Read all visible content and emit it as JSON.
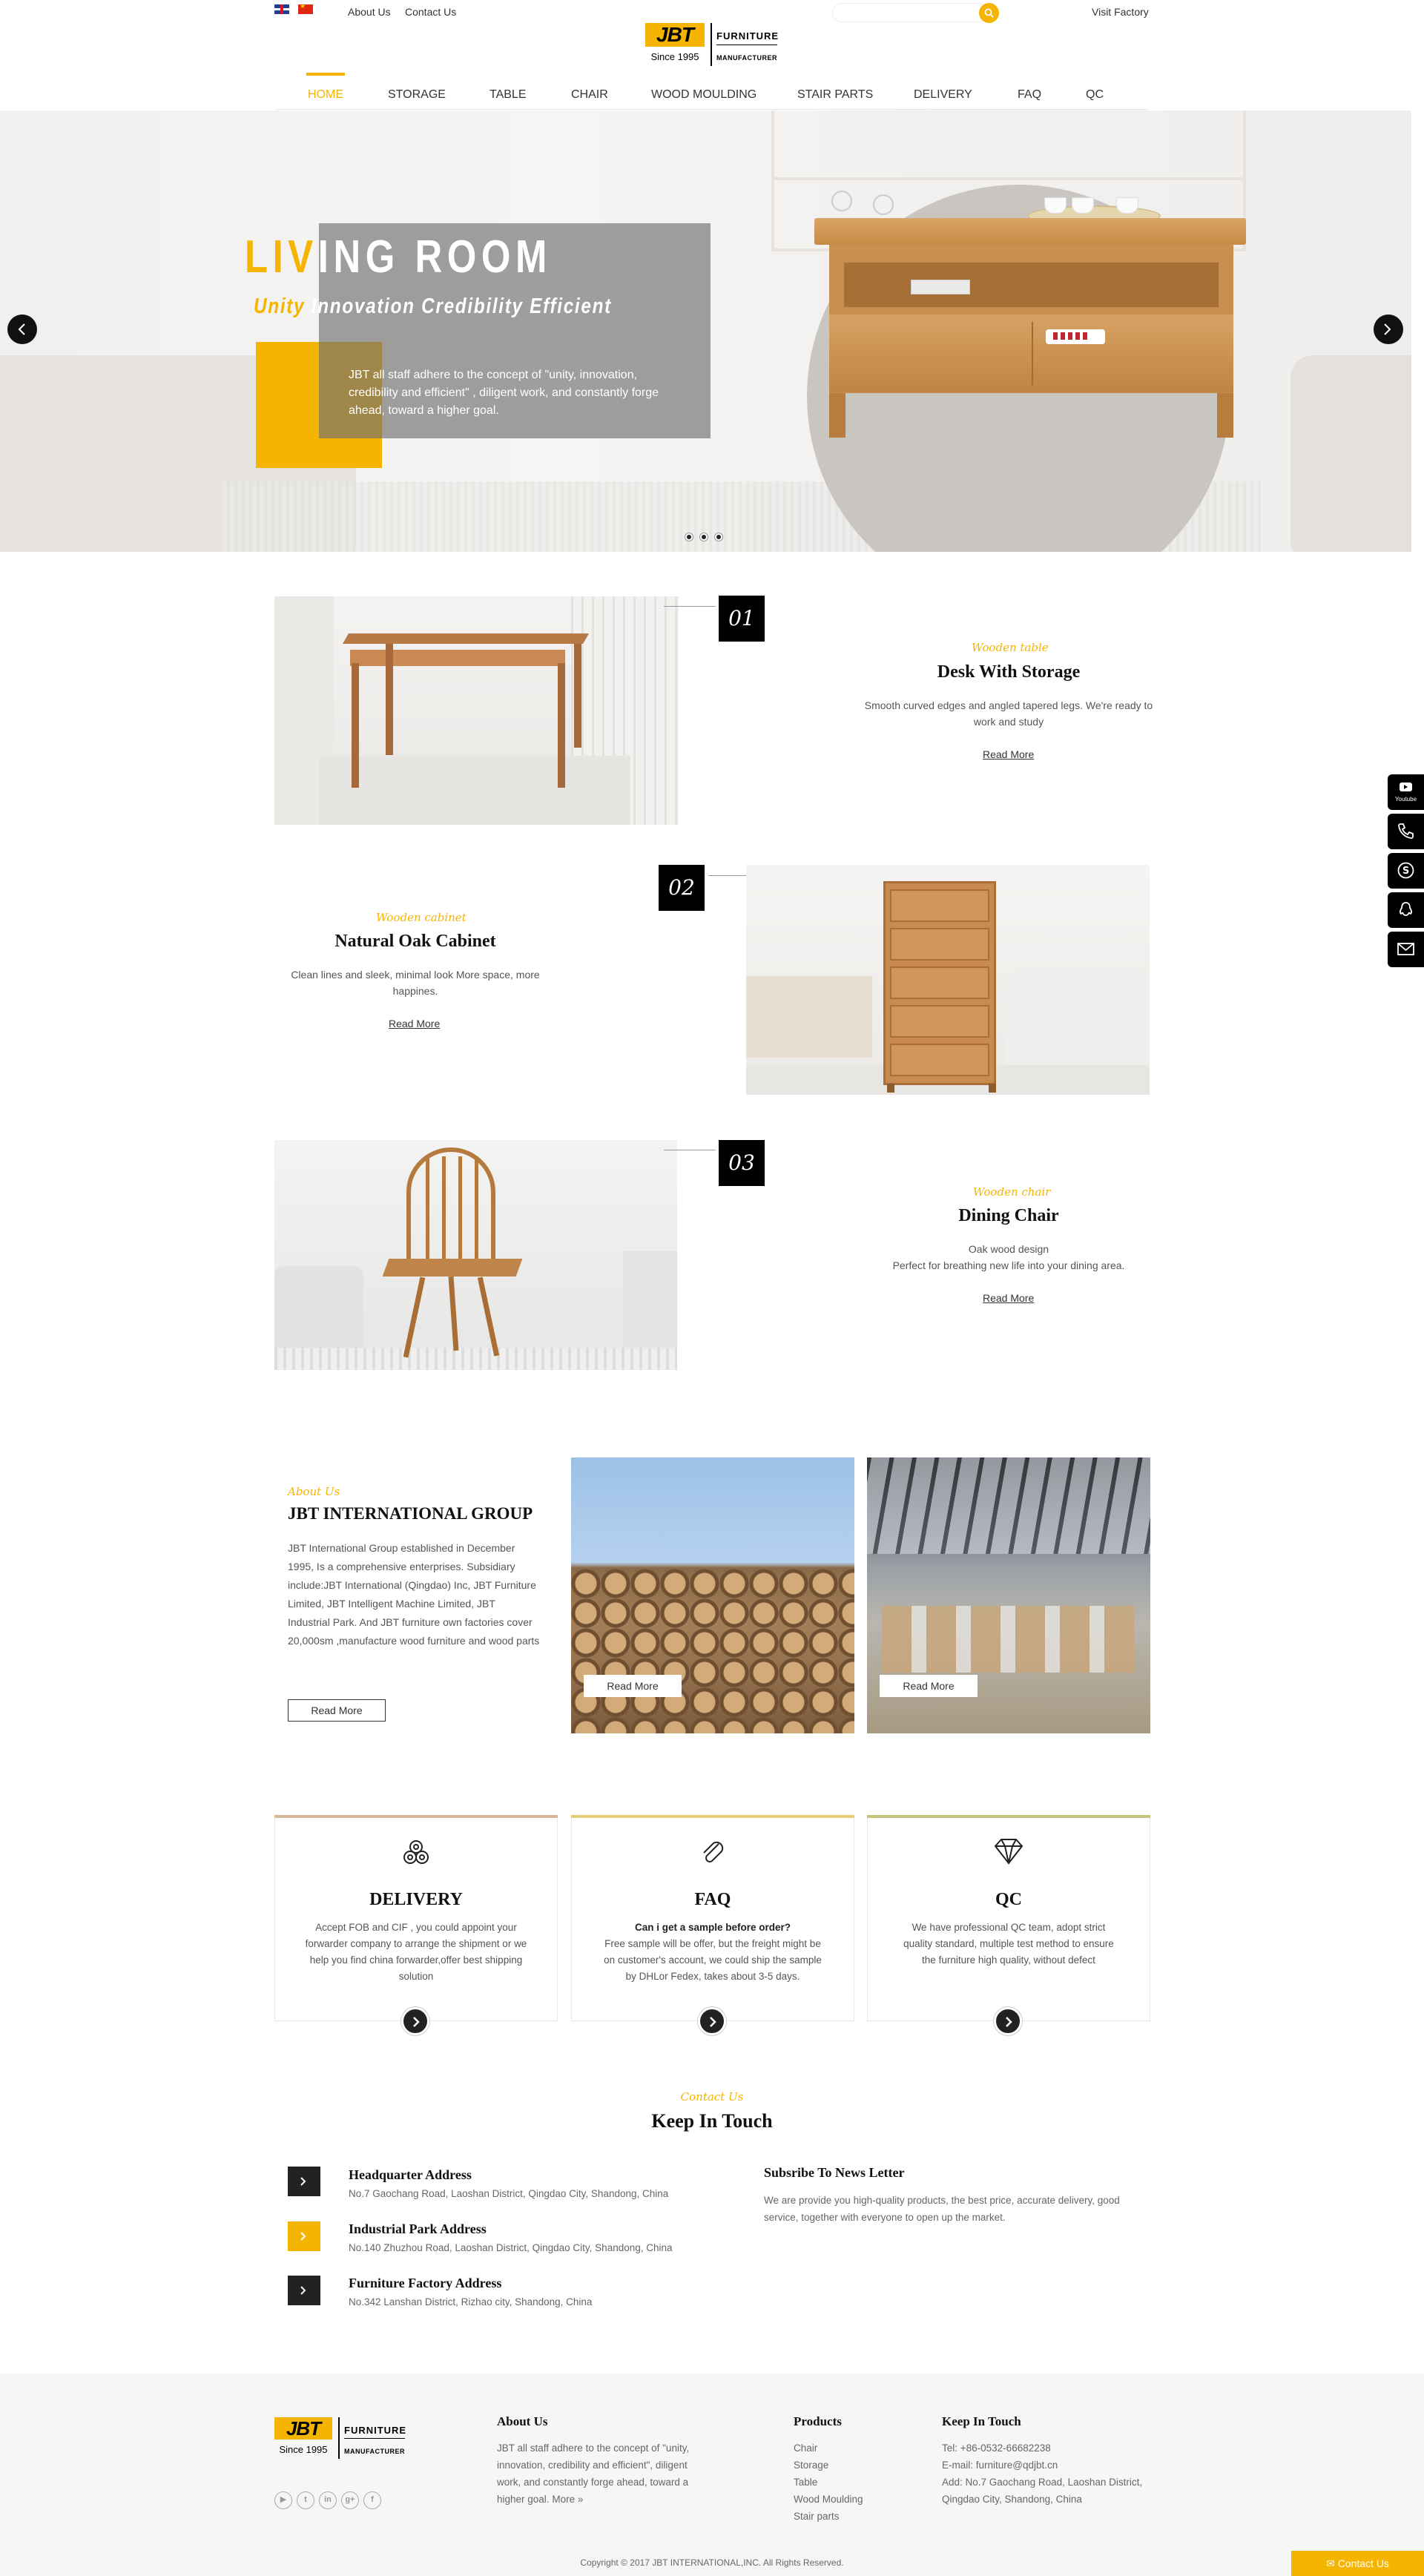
{
  "topbar": {
    "links": [
      "About Us",
      "Contact Us"
    ],
    "search_placeholder": "",
    "visit_factory": "Visit Factory"
  },
  "logo": {
    "mark": "JBT",
    "since": "Since 1995",
    "word1": "FURNITURE",
    "word2": "MANUFACTURER"
  },
  "nav": {
    "items": [
      "HOME",
      "STORAGE",
      "TABLE",
      "CHAIR",
      "WOOD MOULDING",
      "STAIR PARTS",
      "DELIVERY",
      "FAQ",
      "QC"
    ],
    "active": "HOME",
    "active_color": "#f5b400"
  },
  "hero": {
    "title_accent": "LIV",
    "title_rest": "ING ROOM",
    "subtitle_accent": "Unity",
    "subtitle_rest": "Innovation Credibility Efficient",
    "description": "JBT all staff adhere to the concept of \"unity, innovation, credibility and efficient\" , diligent work, and constantly forge ahead, toward a higher goal.",
    "slides": 3,
    "active_slide": 1
  },
  "products": [
    {
      "number": "01",
      "script": "Wooden table",
      "title": "Desk With Storage",
      "desc": "Smooth curved edges and angled tapered legs. We're ready to work and study",
      "link": "Read More"
    },
    {
      "number": "02",
      "script": "Wooden cabinet",
      "title": "Natural Oak Cabinet",
      "desc": "Clean lines and sleek, minimal look More space, more happines.",
      "link": "Read More"
    },
    {
      "number": "03",
      "script": "Wooden chair",
      "title": "Dining Chair",
      "desc_line1": "Oak wood design",
      "desc_line2": "Perfect for breathing new life into your dining area.",
      "link": "Read More"
    }
  ],
  "about": {
    "script": "About Us",
    "title": "JBT INTERNATIONAL GROUP",
    "text": "JBT International Group established in December 1995, Is a comprehensive enterprises. Subsidiary include:JBT International (Qingdao) Inc, JBT Furniture Limited, JBT Intelligent Machine Limited, JBT Industrial Park. And JBT furniture own factories cover 20,000sm ,manufacture wood furniture and wood parts",
    "button": "Read More",
    "image_buttons": [
      "Read More",
      "Read More"
    ]
  },
  "services": [
    {
      "icon": "logs-icon",
      "title": "DELIVERY",
      "text": "Accept FOB and CIF , you could appoint your forwarder company to arrange the shipment or we help you find china forwarder,offer best shipping solution",
      "color": "#d8b79b"
    },
    {
      "icon": "paperclip-icon",
      "title": "FAQ",
      "question": "Can i get a sample before order?",
      "text": "Free sample will be offer, but the freight might be on customer's account, we could ship the sample by DHLor Fedex, takes about 3-5 days.",
      "color": "#e7cf7a"
    },
    {
      "icon": "diamond-icon",
      "title": "QC",
      "text": "We have professional QC team, adopt strict quality standard, multiple test method to ensure the furniture high quality, without defect",
      "color": "#c5c47a"
    }
  ],
  "contact": {
    "script": "Contact Us",
    "title": "Keep In Touch",
    "addresses": [
      {
        "title": "Headquarter Address",
        "text": "No.7 Gaochang Road, Laoshan  District, Qingdao City, Shandong, China"
      },
      {
        "title": "Industrial Park Address",
        "text": "No.140 Zhuzhou Road, Laoshan  District, Qingdao City, Shandong, China"
      },
      {
        "title": "Furniture Factory Address",
        "text": "No.342 Lanshan District, Rizhao city, Shandong, China"
      }
    ],
    "newsletter_title": "Subsribe To News Letter",
    "newsletter_text": "We are provide you high-quality products, the best price, accurate delivery, good service, together with everyone to open up the market."
  },
  "footer": {
    "about_title": "About Us",
    "about_text": "JBT all staff adhere to the concept of \"unity, innovation, credibility and efficient\", diligent work, and constantly forge ahead, toward a higher goal.",
    "about_more": "More »",
    "products_title": "Products",
    "products": [
      "Chair",
      "Storage",
      "Table",
      "Wood Moulding",
      "Stair parts"
    ],
    "touch_title": "Keep In Touch",
    "tel": "Tel: +86-0532-66682238",
    "email": "E-mail: furniture@qdjbt.cn",
    "address": "Add: No.7 Gaochang Road, Laoshan District, Qingdao City, Shandong, China",
    "social_icons": [
      "youtube-icon",
      "twitter-icon",
      "linkedin-icon",
      "googleplus-icon",
      "facebook-icon"
    ],
    "copyright": "Copyright © 2017 JBT INTERNATIONAL,INC. All Rights Reserved.",
    "contact_tab": "Contact Us"
  },
  "sidebar": {
    "youtube_label": "Youtube",
    "icons": [
      "youtube-icon",
      "phone-icon",
      "skype-icon",
      "qq-icon",
      "email-icon"
    ]
  }
}
